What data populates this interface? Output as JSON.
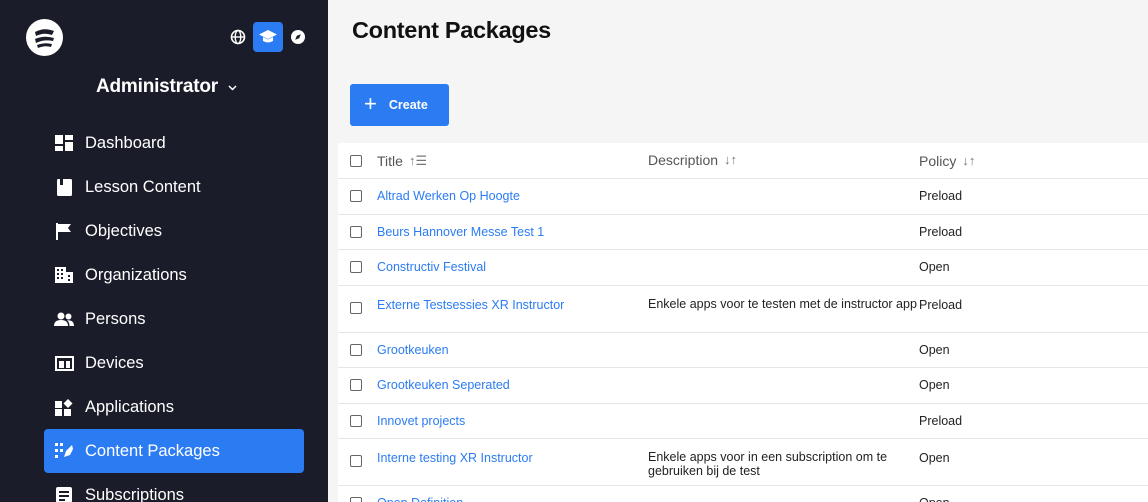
{
  "sidebar": {
    "role": "Administrator",
    "top_icons": [
      "globe-icon",
      "graduation-cap-icon",
      "compass-icon"
    ],
    "items": [
      {
        "label": "Dashboard",
        "icon": "dashboard-icon"
      },
      {
        "label": "Lesson Content",
        "icon": "book-icon"
      },
      {
        "label": "Objectives",
        "icon": "flag-icon"
      },
      {
        "label": "Organizations",
        "icon": "building-icon"
      },
      {
        "label": "Persons",
        "icon": "users-icon"
      },
      {
        "label": "Devices",
        "icon": "devices-icon"
      },
      {
        "label": "Applications",
        "icon": "applications-icon"
      },
      {
        "label": "Content Packages",
        "icon": "content-packages-icon",
        "active": true
      },
      {
        "label": "Subscriptions",
        "icon": "subscriptions-icon"
      }
    ]
  },
  "main": {
    "title": "Content Packages",
    "create_label": "Create",
    "columns": {
      "title": "Title",
      "title_sort": "↑☰",
      "description": "Description",
      "description_sort": "↓↑",
      "policy": "Policy",
      "policy_sort": "↓↑"
    },
    "rows": [
      {
        "title": "Altrad Werken Op Hoogte",
        "description": "",
        "policy": "Preload"
      },
      {
        "title": "Beurs Hannover Messe Test 1",
        "description": "",
        "policy": "Preload"
      },
      {
        "title": "Constructiv Festival",
        "description": "",
        "policy": "Open"
      },
      {
        "title": "Externe Testsessies XR Instructor",
        "description": "Enkele apps voor te testen met de instructor app",
        "policy": "Preload"
      },
      {
        "title": "Grootkeuken",
        "description": "",
        "policy": "Open"
      },
      {
        "title": "Grootkeuken Seperated",
        "description": "",
        "policy": "Open"
      },
      {
        "title": "Innovet projects",
        "description": "",
        "policy": "Preload"
      },
      {
        "title": "Interne testing XR Instructor",
        "description": "Enkele apps voor in een subscription om te gebruiken bij de test",
        "policy": "Open"
      },
      {
        "title": "Open Definition",
        "description": "",
        "policy": "Open"
      }
    ]
  }
}
